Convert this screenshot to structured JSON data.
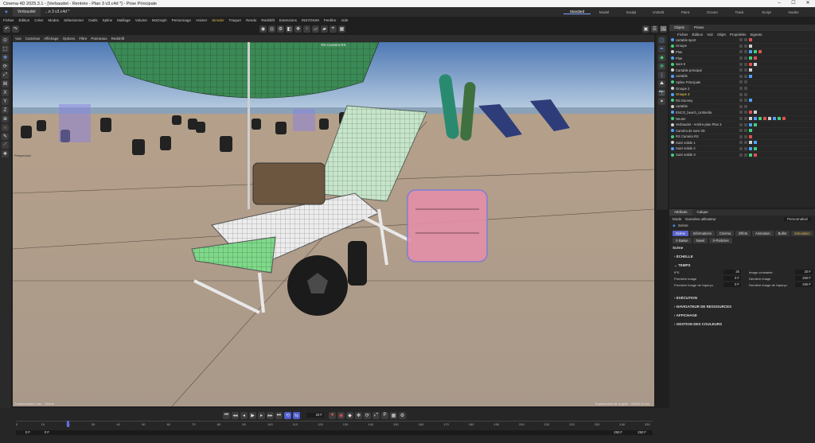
{
  "window": {
    "title": "Cinema 4D 2025.3.1 - [Verbaudet - Rentrée - Plan 3 v3.c4d *] - Prise Principale"
  },
  "doc_tabs": [
    "Verbaudet",
    "...n 3 v3.c4d *"
  ],
  "menu": [
    "Fichier",
    "Édition",
    "Créer",
    "Modes",
    "Sélectionner",
    "Outils",
    "Spline",
    "Maillage",
    "Volume",
    "MoGraph",
    "Personnage",
    "Animer",
    "Simuler",
    "Traquer",
    "Rendu",
    "Redshift",
    "Extensions",
    "INSYDIUM",
    "Fenêtre",
    "Aide"
  ],
  "menu_highlight": "Simuler",
  "layouts": [
    "Standard",
    "Model",
    "Sculpt",
    "UVEdit",
    "Paint",
    "Groom",
    "Track",
    "Script",
    "Nodes"
  ],
  "layouts_active": "Standard",
  "viewport_menu": [
    "Vue",
    "Caméras",
    "Affichage",
    "Options",
    "Filtre",
    "Panneaux",
    "Redshift"
  ],
  "viewport": {
    "camera_label": "RS Caméra RS",
    "view_label": "Perspective",
    "status_left": "Transformation nav. : Scène",
    "status_right": "Espacement de la grille : 10000.10 cm"
  },
  "object_manager": {
    "tabs": [
      "Objets",
      "Prises"
    ],
    "menu": [
      "Fichier",
      "Édition",
      "Voir",
      "Objet",
      "Propriétés",
      "Signets"
    ],
    "rows": [
      {
        "name": "cartable sport",
        "tags": 1
      },
      {
        "name": "Groupe",
        "tags": 1
      },
      {
        "name": "Plan",
        "tags": 3
      },
      {
        "name": "Plan",
        "tags": 2
      },
      {
        "name": "sacs 6",
        "tags": 2
      },
      {
        "name": "Cartable principal",
        "tags": 1
      },
      {
        "name": "cartable",
        "tags": 1
      },
      {
        "name": "Spline Principale",
        "tags": 0
      },
      {
        "name": "Groupe 2",
        "tags": 0
      },
      {
        "name": "Groupe 3",
        "tags": 0
      },
      {
        "name": "RS Dummy",
        "tags": 1
      },
      {
        "name": "cartable",
        "tags": 0
      },
      {
        "name": "ENCO_beach_Umbrella",
        "tags": 2
      },
      {
        "name": "Neutre",
        "tags": 8
      },
      {
        "name": "Verbaudet - Arrière-plan Plan 3",
        "tags": 2
      },
      {
        "name": "Caméra de suivi 3D",
        "tags": 1
      },
      {
        "name": "RS Caméra RS",
        "tags": 1
      },
      {
        "name": "Suivi solide 1",
        "tags": 2
      },
      {
        "name": "Suivi solide 2",
        "tags": 2
      },
      {
        "name": "Suivi solide 3",
        "tags": 2
      }
    ],
    "highlight_row": "Groupe 3"
  },
  "attributes": {
    "tabs": [
      "Attributs",
      "Calque"
    ],
    "menu": [
      "Mode",
      "Données utilisateur"
    ],
    "preset": "Personnalisé",
    "title": "Scène",
    "pills_row1": [
      "Scène",
      "Informations",
      "Cinéma",
      "Effets",
      "Animation",
      "Bullet",
      "Simulation"
    ],
    "pills_row2": [
      "À Basse",
      "Nuvel",
      "X-Particles"
    ],
    "section": "Scène",
    "groups": [
      "ÉCHELLE",
      "TEMPS",
      "EXÉCUTION",
      "NAVIGATEUR DE RESSOURCES",
      "AFFICHAGE",
      "GESTION DES COULEURS"
    ],
    "time": {
      "ips_label": "IPS",
      "ips": "25",
      "first_label": "Première image",
      "first": "0 F",
      "preview_label": "Première image de l'aperçu",
      "preview": "0 F",
      "duration_label": "Image constante",
      "duration": "20 F",
      "last_label": "Dernière image",
      "last": "250 F",
      "preview_last_label": "Dernière image de l'aperçu",
      "preview_last": "250 F"
    }
  },
  "timeline": {
    "ticks": [
      "0",
      "10",
      "20",
      "30",
      "40",
      "50",
      "60",
      "70",
      "80",
      "90",
      "100",
      "110",
      "120",
      "130",
      "140",
      "150",
      "160",
      "170",
      "180",
      "190",
      "200",
      "210",
      "220",
      "230",
      "240",
      "250"
    ],
    "current_frame": "20 F",
    "start_a": "0 F",
    "start_b": "0 F",
    "end_a": "250 F",
    "end_b": "250 F"
  },
  "colors": {
    "accent": "#5a63c9",
    "highlight": "#e8b84a",
    "active_obj": "#ffd84a"
  }
}
